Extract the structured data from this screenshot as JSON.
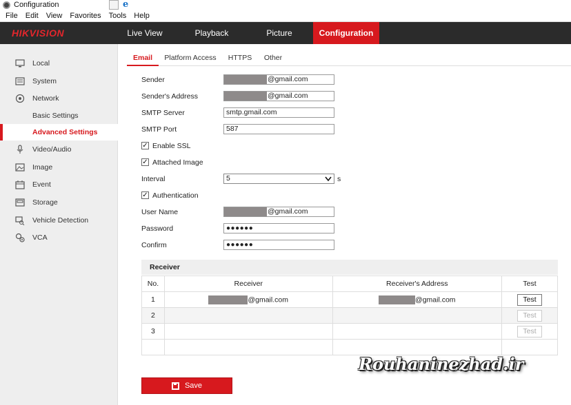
{
  "window": {
    "title": "Configuration"
  },
  "menu": [
    "File",
    "Edit",
    "View",
    "Favorites",
    "Tools",
    "Help"
  ],
  "brand": {
    "part1": "HIK",
    "part2": "VISION",
    "accent": "#d7191e"
  },
  "topnav": [
    "Live View",
    "Playback",
    "Picture",
    "Configuration"
  ],
  "sidebar": {
    "items": [
      {
        "label": "Local",
        "icon": "monitor-icon"
      },
      {
        "label": "System",
        "icon": "system-icon"
      },
      {
        "label": "Network",
        "icon": "globe-icon"
      },
      {
        "label": "Basic Settings",
        "icon": ""
      },
      {
        "label": "Advanced Settings",
        "icon": ""
      },
      {
        "label": "Video/Audio",
        "icon": "microphone-icon"
      },
      {
        "label": "Image",
        "icon": "image-icon"
      },
      {
        "label": "Event",
        "icon": "calendar-icon"
      },
      {
        "label": "Storage",
        "icon": "storage-icon"
      },
      {
        "label": "Vehicle Detection",
        "icon": "vehicle-search-icon"
      },
      {
        "label": "VCA",
        "icon": "vca-gear-icon"
      }
    ]
  },
  "tabs": [
    "Email",
    "Platform Access",
    "HTTPS",
    "Other"
  ],
  "form": {
    "sender_label": "Sender",
    "sender_value": "@gmail.com",
    "sender_address_label": "Sender's Address",
    "sender_address_value": "@gmail.com",
    "smtp_server_label": "SMTP Server",
    "smtp_server_value": "smtp.gmail.com",
    "smtp_port_label": "SMTP Port",
    "smtp_port_value": "587",
    "enable_ssl_label": "Enable SSL",
    "attached_image_label": "Attached Image",
    "interval_label": "Interval",
    "interval_value": "5",
    "interval_unit": "s",
    "authentication_label": "Authentication",
    "username_label": "User Name",
    "username_value": "@gmail.com",
    "password_label": "Password",
    "password_value": "●●●●●●",
    "confirm_label": "Confirm",
    "confirm_value": "●●●●●●"
  },
  "receiver": {
    "title": "Receiver",
    "headers": [
      "No.",
      "Receiver",
      "Receiver's Address",
      "Test"
    ],
    "rows": [
      {
        "no": "1",
        "receiver": "@gmail.com",
        "address": "@gmail.com",
        "test": "Test"
      },
      {
        "no": "2",
        "receiver": "",
        "address": "",
        "test": "Test"
      },
      {
        "no": "3",
        "receiver": "",
        "address": "",
        "test": "Test"
      }
    ]
  },
  "save_label": "Save",
  "watermark": "Rouhaninezhad.ir"
}
